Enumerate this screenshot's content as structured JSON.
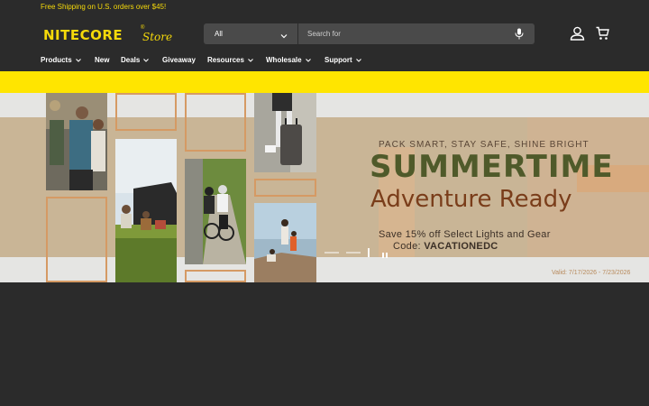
{
  "promo": {
    "text": "Free Shipping on U.S. orders over $45!"
  },
  "logo": {
    "brand": "NITECORE",
    "reg": "®",
    "store": "Store"
  },
  "search": {
    "category": "All",
    "placeholder": "Search for"
  },
  "nav": {
    "items": [
      {
        "label": "Products",
        "dropdown": true
      },
      {
        "label": "New",
        "dropdown": false
      },
      {
        "label": "Deals",
        "dropdown": true
      },
      {
        "label": "Giveaway",
        "dropdown": false
      },
      {
        "label": "Resources",
        "dropdown": true
      },
      {
        "label": "Wholesale",
        "dropdown": true
      },
      {
        "label": "Support",
        "dropdown": true
      }
    ]
  },
  "hero": {
    "tagline": "PACK SMART, STAY SAFE, SHINE BRIGHT",
    "headline": "SUMMERTIME",
    "subheadline": "Adventure Ready",
    "offer": "Save 15% off Select Lights and Gear",
    "code_label": "Code:",
    "code": "VACATIONEDC",
    "valid": "Valid: 7/17/2026 - 7/23/2026"
  },
  "colors": {
    "accent": "#f5d90a",
    "banner_yellow": "#ffe500",
    "background": "#2b2b2b",
    "headline_green": "#4f5a2a",
    "subheadline_brown": "#7a3d1a"
  },
  "icons": {
    "mic": "microphone-icon",
    "account": "user-icon",
    "cart": "cart-icon",
    "chevron": "chevron-down-icon",
    "pause": "pause-icon"
  }
}
